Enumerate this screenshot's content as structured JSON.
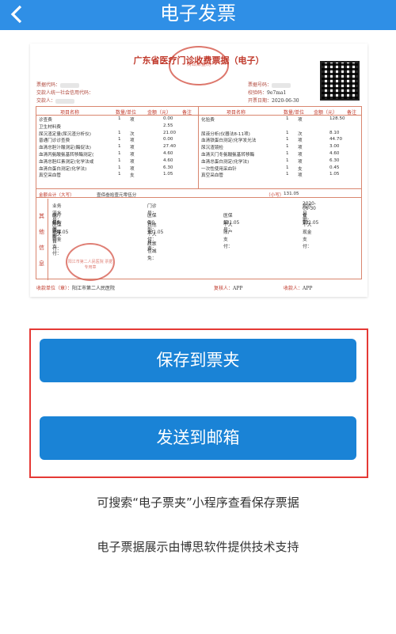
{
  "header": {
    "title": "电子发票"
  },
  "invoice": {
    "title": "广东省医疗门诊收费票据（电子）",
    "stamp_top": "财政部监制",
    "left_meta": [
      "票据代码：",
      "交款人统一社会信用代码：",
      "交款人："
    ],
    "right_meta": [
      "票据号码：",
      "校验码：",
      "开票日期："
    ],
    "check_code": "9e7ma1",
    "issue_date": "2020-06-30",
    "columns": [
      "项目名称",
      "数量/单位",
      "金额（元）",
      "备注",
      "项目名称",
      "数量/单位",
      "金额（元）",
      "备注"
    ],
    "left_items": [
      {
        "name": "诊查费",
        "qty": "1",
        "unit": "项",
        "amount": "0.00"
      },
      {
        "name": "卫生材料费",
        "qty": "",
        "unit": "",
        "amount": "2.55"
      },
      {
        "name": "尿沉渣定量(尿沉渣分析仪)",
        "qty": "1",
        "unit": "次",
        "amount": "21.00"
      },
      {
        "name": "普通门诊诊查费",
        "qty": "1",
        "unit": "项",
        "amount": "0.00"
      },
      {
        "name": "血清总胆汁酸测定(酶促法)",
        "qty": "1",
        "unit": "项",
        "amount": "27.40"
      },
      {
        "name": "血清丙氨酸氨基转移酶测定(",
        "qty": "1",
        "unit": "项",
        "amount": "4.60"
      },
      {
        "name": "血清总胆红素测定(化学法或",
        "qty": "1",
        "unit": "项",
        "amount": "4.60"
      },
      {
        "name": "血清白蛋白测定(化学法)",
        "qty": "1",
        "unit": "项",
        "amount": "6.30"
      },
      {
        "name": "真空采血管",
        "qty": "1",
        "unit": "支",
        "amount": "1.05"
      }
    ],
    "right_items": [
      {
        "name": "化验费",
        "qty": "1",
        "unit": "项",
        "amount": "128.50"
      },
      {
        "name": "",
        "qty": "",
        "unit": "",
        "amount": ""
      },
      {
        "name": "尿液分析(仪器法8-11项)",
        "qty": "1",
        "unit": "次",
        "amount": "8.10"
      },
      {
        "name": "血清铁蛋白测定(化学发光法",
        "qty": "1",
        "unit": "项",
        "amount": "44.70"
      },
      {
        "name": "尿沉渣镜检",
        "qty": "1",
        "unit": "项",
        "amount": "3.00"
      },
      {
        "name": "血清天门冬氨酸氨基转移酶",
        "qty": "1",
        "unit": "项",
        "amount": "4.60"
      },
      {
        "name": "血清总蛋白测定(化学法)",
        "qty": "1",
        "unit": "项",
        "amount": "6.30"
      },
      {
        "name": "一次性使用采血针",
        "qty": "1",
        "unit": "支",
        "amount": "0.45"
      },
      {
        "name": "真空采血管",
        "qty": "1",
        "unit": "项",
        "amount": "1.05"
      }
    ],
    "total_label": "金额合计（大写）",
    "total_upper": "壹佰叁拾壹元零伍分",
    "total_lower_label": "（小写）",
    "total_lower": "131.05",
    "other_label": "其他信息",
    "other": {
      "serial_label": "业务流水号：",
      "outpatient_label": "门诊号：",
      "visit_date_label": "就诊日期：",
      "visit_date": "2020-06-30",
      "org_type_label": "医疗机构类型：",
      "org_type": "综合医院",
      "insurance_type_label": "医保类型：",
      "insurance_no_label": "医保编号：",
      "gender_label": "性别：",
      "gender": "女",
      "fund_label": "医保统筹基金支付：",
      "fund": "0.0",
      "other_pay_label": "其他支付：",
      "other_pay": "0.0",
      "account_pay_label": "个人账户支付：",
      "account_pay": "131.05",
      "cash_pay_label": "个人现金支付：",
      "cash_pay": "131.05",
      "self_pay_label": "个人自付：",
      "self_pay": "131.05",
      "self_fee_label": "个人自费：",
      "self_fee": "131.05",
      "policy_label": "政策性减免："
    },
    "stamp_bottom": "阳江市第二人民医院 票据专用章",
    "payee_unit_label": "收款单位（章）：",
    "payee_unit": "阳江市第二人民医院",
    "reviewer_label": "复核人：",
    "reviewer": "APP",
    "payee_label": "收款人：",
    "payee": "APP"
  },
  "actions": {
    "save": "保存到票夹",
    "email": "发送到邮箱"
  },
  "notes": {
    "line1": "可搜索“电子票夹”小程序查看保存票据",
    "line2": "电子票据展示由博思软件提供技术支持"
  }
}
